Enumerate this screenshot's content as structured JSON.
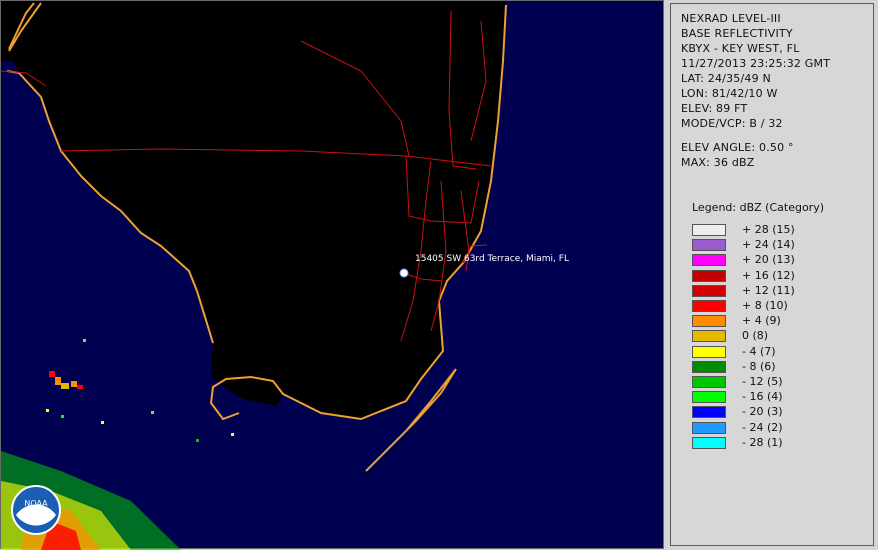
{
  "header": {
    "product": "NEXRAD LEVEL-III",
    "type": "BASE REFLECTIVITY",
    "station": "KBYX - KEY WEST, FL",
    "datetime": "11/27/2013 23:25:32 GMT",
    "lat": "LAT: 24/35/49 N",
    "lon": "LON: 81/42/10 W",
    "elev": "ELEV: 89 FT",
    "mode": "MODE/VCP: B / 32",
    "elev_angle": "ELEV ANGLE: 0.50 °",
    "max": "MAX: 36 dBZ"
  },
  "location_label": "15405 SW 63rd Terrace, Miami, FL",
  "legend": {
    "title": "Legend: dBZ (Category)",
    "items": [
      {
        "label": "+ 28  (15)",
        "color": "#eeeeee"
      },
      {
        "label": "+ 24  (14)",
        "color": "#9a5ccc"
      },
      {
        "label": "+ 20  (13)",
        "color": "#ff00ff"
      },
      {
        "label": "+ 16  (12)",
        "color": "#c40000"
      },
      {
        "label": "+ 12  (11)",
        "color": "#d40000"
      },
      {
        "label": "+ 8  (10)",
        "color": "#ff0000"
      },
      {
        "label": "+ 4  (9)",
        "color": "#ff8c00"
      },
      {
        "label": "0  (8)",
        "color": "#e6b800"
      },
      {
        "label": "- 4  (7)",
        "color": "#ffff00"
      },
      {
        "label": "- 8  (6)",
        "color": "#008c00"
      },
      {
        "label": "- 12  (5)",
        "color": "#00c800"
      },
      {
        "label": "- 16  (4)",
        "color": "#00ff00"
      },
      {
        "label": "- 20  (3)",
        "color": "#0000ff"
      },
      {
        "label": "- 24  (2)",
        "color": "#1e9bff"
      },
      {
        "label": "- 28  (1)",
        "color": "#00ffff"
      }
    ]
  },
  "colors": {
    "water": "#000050",
    "land": "#000000",
    "coastline": "#f0a030",
    "roads": "#cc1111"
  },
  "logo_text": "NOAA"
}
